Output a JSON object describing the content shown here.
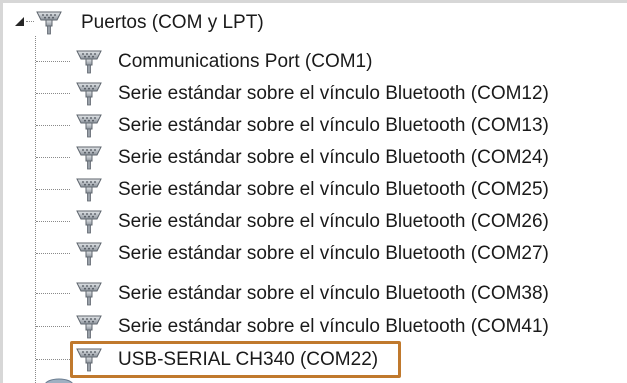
{
  "tree": {
    "root": {
      "label": "Puertos (COM y LPT)",
      "icon": "port-connector-icon",
      "expanded": true
    },
    "children": [
      {
        "label": "Communications Port (COM1)",
        "icon": "port-connector-icon"
      },
      {
        "label": "Serie estándar sobre el vínculo Bluetooth (COM12)",
        "icon": "port-connector-icon"
      },
      {
        "label": "Serie estándar sobre el vínculo Bluetooth (COM13)",
        "icon": "port-connector-icon"
      },
      {
        "label": "Serie estándar sobre el vínculo Bluetooth (COM24)",
        "icon": "port-connector-icon"
      },
      {
        "label": "Serie estándar sobre el vínculo Bluetooth (COM25)",
        "icon": "port-connector-icon"
      },
      {
        "label": "Serie estándar sobre el vínculo Bluetooth (COM26)",
        "icon": "port-connector-icon"
      },
      {
        "label": "Serie estándar sobre el vínculo Bluetooth (COM27)",
        "icon": "port-connector-icon"
      },
      {
        "label": "Serie estándar sobre el vínculo Bluetooth (COM38)",
        "icon": "port-connector-icon"
      },
      {
        "label": "Serie estándar sobre el vínculo Bluetooth (COM41)",
        "icon": "port-connector-icon"
      },
      {
        "label": "USB-SERIAL CH340 (COM22)",
        "icon": "port-connector-icon",
        "highlighted": true
      }
    ]
  },
  "colors": {
    "highlight_border": "#c0792d",
    "icon_body": "#b9bec4",
    "connector_line": "#8a8a8a"
  }
}
